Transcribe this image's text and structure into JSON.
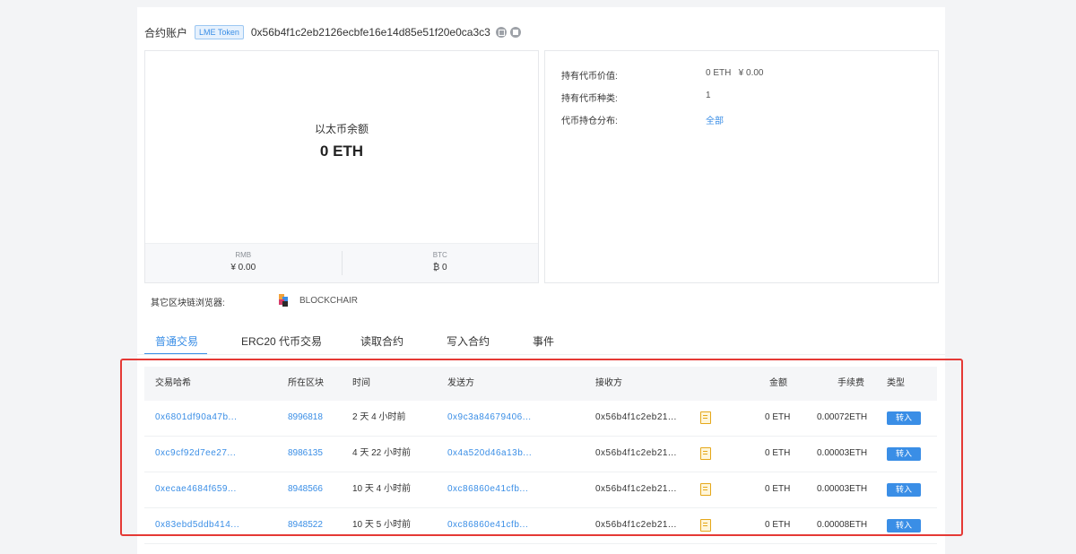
{
  "header": {
    "title": "合约账户",
    "badge": "LME Token",
    "address": "0x56b4f1c2eb2126ecbfe16e14d85e51f20e0ca3c3"
  },
  "balance": {
    "label": "以太币余额",
    "value": "0 ETH",
    "rmb_label": "RMB",
    "rmb_value": "¥ 0.00",
    "btc_label": "BTC",
    "btc_value": "₿ 0"
  },
  "holdings": {
    "value_label": "持有代币价值:",
    "value": "0 ETH   ¥ 0.00",
    "kinds_label": "持有代币种类:",
    "kinds": "1",
    "dist_label": "代币持仓分布:",
    "dist_link": "全部"
  },
  "explorers": {
    "label": "其它区块链浏览器:",
    "name": "BLOCKCHAIR"
  },
  "tabs": [
    "普通交易",
    "ERC20 代币交易",
    "读取合约",
    "写入合约",
    "事件"
  ],
  "table": {
    "headers": {
      "hash": "交易哈希",
      "block": "所在区块",
      "time": "时间",
      "from": "发送方",
      "to": "接收方",
      "amount": "金额",
      "fee": "手续费",
      "type": "类型"
    },
    "rows": [
      {
        "hash": "0x6801df90a47b...",
        "block": "8996818",
        "time": "2 天 4 小时前",
        "from": "0x9c3a84679406...",
        "to": "0x56b4f1c2eb21...",
        "amount": "0 ETH",
        "fee": "0.00072ETH",
        "type": "转入"
      },
      {
        "hash": "0xc9cf92d7ee27...",
        "block": "8986135",
        "time": "4 天 22 小时前",
        "from": "0x4a520d46a13b...",
        "to": "0x56b4f1c2eb21...",
        "amount": "0 ETH",
        "fee": "0.00003ETH",
        "type": "转入"
      },
      {
        "hash": "0xecae4684f659...",
        "block": "8948566",
        "time": "10 天 4 小时前",
        "from": "0xc86860e41cfb...",
        "to": "0x56b4f1c2eb21...",
        "amount": "0 ETH",
        "fee": "0.00003ETH",
        "type": "转入"
      },
      {
        "hash": "0x83ebd5ddb414...",
        "block": "8948522",
        "time": "10 天 5 小时前",
        "from": "0xc86860e41cfb...",
        "to": "0x56b4f1c2eb21...",
        "amount": "0 ETH",
        "fee": "0.00008ETH",
        "type": "转入"
      }
    ]
  },
  "colors": {
    "accent": "#3a8ee6",
    "highlight": "#e53935",
    "contract_icon": "#e5a719"
  },
  "icons": [
    "copy-icon",
    "qrcode-icon",
    "blockchair-logo-icon",
    "contract-icon"
  ]
}
